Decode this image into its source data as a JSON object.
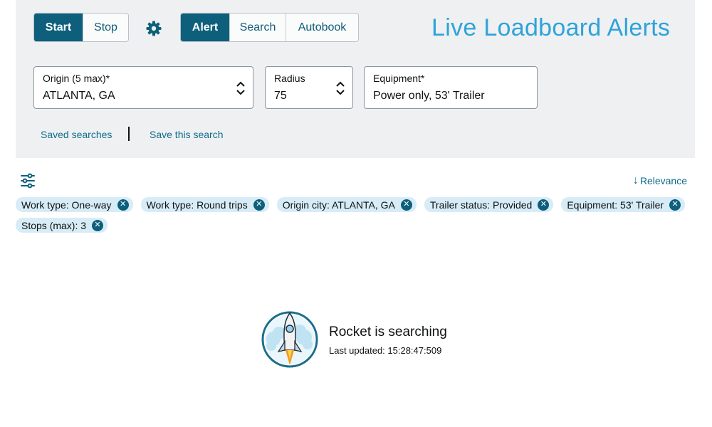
{
  "header": {
    "title": "Live Loadboard Alerts",
    "run_buttons": [
      {
        "label": "Start",
        "active": true
      },
      {
        "label": "Stop",
        "active": false
      }
    ],
    "mode_buttons": [
      {
        "label": "Alert",
        "active": true
      },
      {
        "label": "Search",
        "active": false
      },
      {
        "label": "Autobook",
        "active": false
      }
    ],
    "settings_icon": "gear-icon"
  },
  "search_form": {
    "origin": {
      "label": "Origin (5 max)*",
      "value": "ATLANTA, GA"
    },
    "radius": {
      "label": "Radius",
      "value": "75"
    },
    "equipment": {
      "label": "Equipment*",
      "value": "Power only, 53' Trailer"
    },
    "saved_searches_label": "Saved searches",
    "save_search_label": "Save this search"
  },
  "results_bar": {
    "filter_icon": "sliders-icon",
    "sort_label": "Relevance"
  },
  "filter_chips": [
    "Work type: One-way",
    "Work type: Round trips",
    "Origin city: ATLANTA, GA",
    "Trailer status: Provided",
    "Equipment: 53' Trailer",
    "Stops (max): 3"
  ],
  "status": {
    "title": "Rocket is searching",
    "last_updated": "Last updated: 15:28:47:509",
    "icon": "rocket-icon"
  },
  "colors": {
    "accent": "#0d5f7c",
    "title": "#2ea3d9",
    "chip_bg": "#d7ecf6",
    "panel_bg": "#eef0f2",
    "link": "#0f6c8c"
  }
}
